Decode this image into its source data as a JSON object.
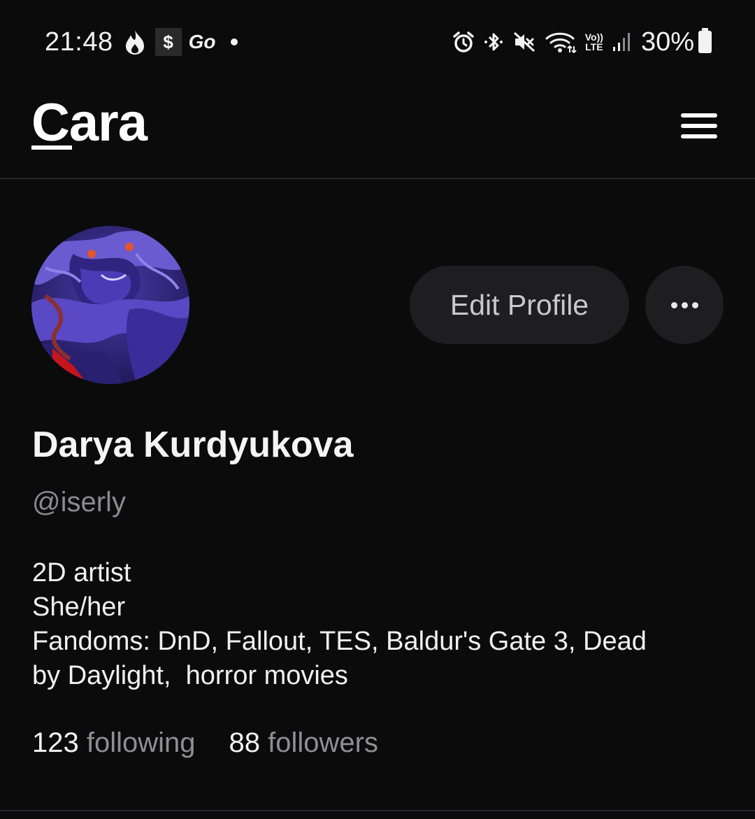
{
  "status_bar": {
    "time": "21:48",
    "app_icons": [
      "flame-icon",
      "s-app-icon",
      "go-app-icon",
      "notification-dot"
    ],
    "app_s_label": "$",
    "app_go_label": "Go",
    "volte_top": "Vo))",
    "volte_bottom": "LTE",
    "battery_percent": "30%"
  },
  "header": {
    "logo": "Cara",
    "menu_icon": "hamburger-icon"
  },
  "profile": {
    "edit_profile_label": "Edit Profile",
    "more_icon": "ellipsis-icon",
    "display_name": "Darya Kurdyukova",
    "username": "@iserly",
    "bio": [
      "2D artist",
      "She/her",
      "Fandoms: DnD, Fallout, TES, Baldur's Gate 3, Dead",
      "by Daylight,  horror movies"
    ],
    "following_count": "123",
    "following_label": "following",
    "followers_count": "88",
    "followers_label": "followers"
  },
  "colors": {
    "background": "#0b0b0c",
    "button_bg": "#1e1e21",
    "muted_text": "#8a8a8f",
    "divider": "#26262c"
  }
}
